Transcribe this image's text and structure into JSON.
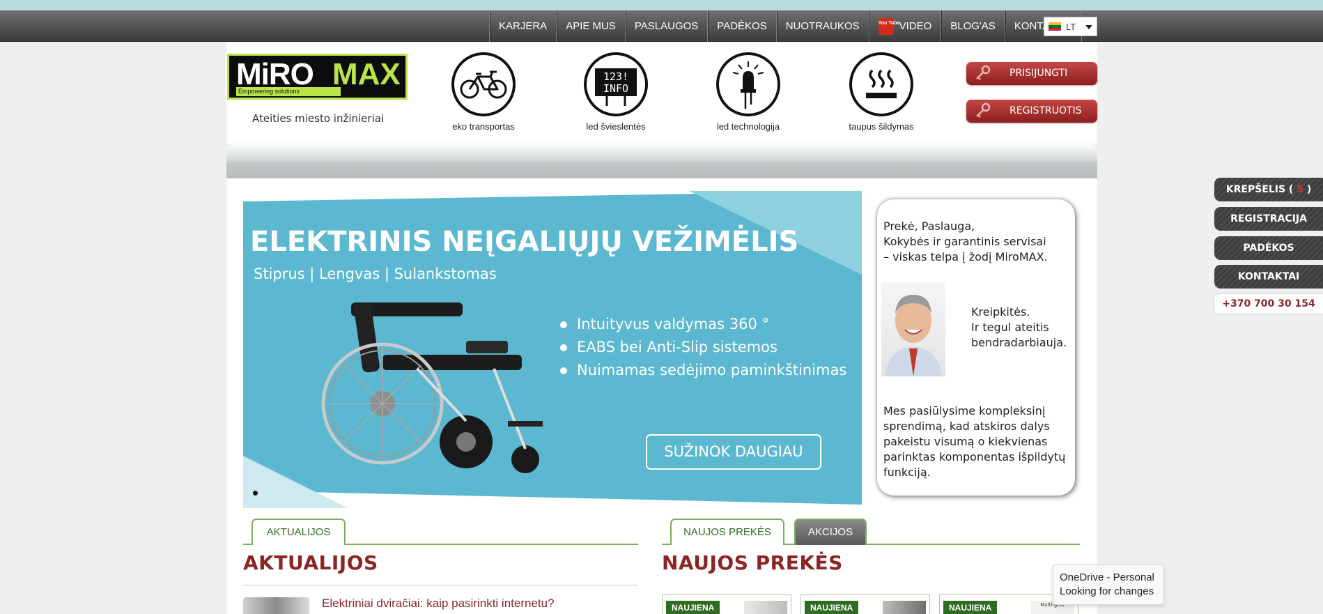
{
  "nav": {
    "items": [
      {
        "label": "KARJERA"
      },
      {
        "label": "APIE MUS"
      },
      {
        "label": "PASLAUGOS"
      },
      {
        "label": "PADĖKOS"
      },
      {
        "label": "NUOTRAUKOS"
      },
      {
        "label": "VIDEO",
        "icon": "youtube-icon"
      },
      {
        "label": "BLOG'AS"
      },
      {
        "label": "KONTAKTAI"
      }
    ],
    "youtube_icon_text": "You Tube",
    "language": "LT"
  },
  "header": {
    "logo": {
      "text_a": "MiRO",
      "text_b": "MAX",
      "tagline": "Empowering solutions"
    },
    "slogan": "Ateities miesto inžinieriai",
    "categories": [
      {
        "label": "eko transportas",
        "icon": "bicycle-icon"
      },
      {
        "label": "led švieslentės",
        "icon": "led-board-icon",
        "board_text_a": "123!",
        "board_text_b": "INFO"
      },
      {
        "label": "led technologija",
        "icon": "led-bulb-icon"
      },
      {
        "label": "taupus šildymas",
        "icon": "heating-icon"
      }
    ],
    "login_label": "PRISIJUNGTI",
    "register_label": "REGISTRUOTIS"
  },
  "banner": {
    "title": "ELEKTRINIS NEĮGALIŲJŲ VEŽIMĖLIS",
    "subtitle": "Stiprus  |  Lengvas  |  Sulankstomas",
    "features": [
      "Intuityvus valdymas 360 °",
      "EABS bei Anti-Slip sistemos",
      "Nuimamas sedėjimo paminkštinimas"
    ],
    "cta": "SUŽINOK DAUGIAU",
    "bg_color": "#5bb8d0"
  },
  "aside": {
    "text1": "Prekė, Paslauga,\nKokybės ir garantinis servisai\n– viskas telpa į žodį MiroMAX.",
    "text2": "Kreipkitės.\nIr tegul ateitis\nbendradarbiauja.",
    "text3": "Mes pasiūlysime kompleksinį sprendimą, kad atskiros dalys pakeistu visumą o kiekvienas parinktas komponentas išpildytų funkciją."
  },
  "news": {
    "tab_label": "AKTUALIJOS",
    "title": "AKTUALIJOS",
    "first_item": "Elektriniai dviračiai: kaip pasirinkti internetu?"
  },
  "products": {
    "tabs": [
      {
        "label": "NAUJOS PREKĖS"
      },
      {
        "label": "AKCIJOS"
      }
    ],
    "title": "NAUJOS PREKĖS",
    "badge": "NAUJIENA",
    "third_img_text": "Multi-gear"
  },
  "side": {
    "cart_label": "KREPŠELIS (",
    "cart_count": "5",
    "cart_close": ")",
    "registration_label": "REGISTRACIJA",
    "thanks_label": "PADĖKOS",
    "contacts_label": "KONTAKTAI",
    "phone": "+370 700 30 154"
  },
  "toast": {
    "line1": "OneDrive - Personal",
    "line2": "Looking for changes"
  },
  "colors": {
    "accent_red": "#8b2525",
    "green": "#7cae5f",
    "logo_green": "#b9e54a"
  }
}
